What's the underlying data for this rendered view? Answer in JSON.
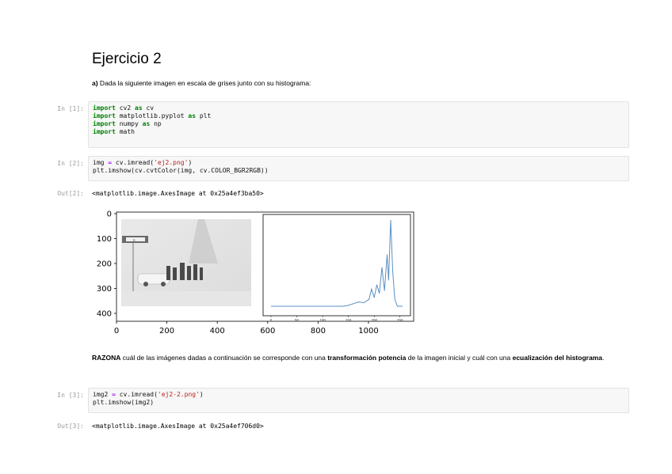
{
  "heading": "Ejercicio 2",
  "intro": {
    "bold": "a)",
    "text": " Dada la siguiente imagen en escala de grises junto con su histograma:"
  },
  "cells": [
    {
      "prompt": "In [1]:",
      "lines": [
        [
          {
            "t": "kw",
            "v": "import"
          },
          {
            "t": "",
            "v": " cv2 "
          },
          {
            "t": "kw",
            "v": "as"
          },
          {
            "t": "",
            "v": " cv"
          }
        ],
        [
          {
            "t": "kw",
            "v": "import"
          },
          {
            "t": "",
            "v": " matplotlib.pyplot "
          },
          {
            "t": "kw",
            "v": "as"
          },
          {
            "t": "",
            "v": " plt"
          }
        ],
        [
          {
            "t": "kw",
            "v": "import"
          },
          {
            "t": "",
            "v": " numpy "
          },
          {
            "t": "kw",
            "v": "as"
          },
          {
            "t": "",
            "v": " np"
          }
        ],
        [
          {
            "t": "kw",
            "v": "import"
          },
          {
            "t": "",
            "v": " math"
          }
        ]
      ]
    },
    {
      "prompt": "In [2]:",
      "lines": [
        [
          {
            "t": "",
            "v": "img "
          },
          {
            "t": "op",
            "v": "="
          },
          {
            "t": "",
            "v": " cv.imread("
          },
          {
            "t": "str",
            "v": "'ej2.png'"
          },
          {
            "t": "",
            "v": ")"
          }
        ],
        [
          {
            "t": "",
            "v": "plt.imshow(cv.cvtColor(img, cv.COLOR_BGR2RGB))"
          }
        ]
      ]
    },
    {
      "prompt": "In [3]:",
      "lines": [
        [
          {
            "t": "",
            "v": "img2 "
          },
          {
            "t": "op",
            "v": "="
          },
          {
            "t": "",
            "v": " cv.imread("
          },
          {
            "t": "str",
            "v": "'ej2-2.png'"
          },
          {
            "t": "",
            "v": ")"
          }
        ],
        [
          {
            "t": "",
            "v": "plt.imshow(img2)"
          }
        ]
      ]
    }
  ],
  "outputs": [
    {
      "prompt": "Out[2]:",
      "text": "<matplotlib.image.AxesImage at 0x25a4ef3ba50>"
    },
    {
      "prompt": "Out[3]:",
      "text": "<matplotlib.image.AxesImage at 0x25a4ef706d0>"
    }
  ],
  "plot": {
    "y_ticks": [
      "0",
      "100",
      "200",
      "300",
      "400"
    ],
    "x_ticks": [
      "0",
      "200",
      "400",
      "600",
      "800",
      "1000"
    ],
    "hist_x_ticks": [
      "0",
      "50",
      "100",
      "150",
      "200",
      "250"
    ],
    "sign_text": "K"
  },
  "razona": {
    "b1": "RAZONA",
    "t1": " cuál de las imágenes dadas a continuación se corresponde con una ",
    "b2": "transformación potencia",
    "t2": " de la imagen inicial y cuál con una ",
    "b3": "ecualización del histograma",
    "t3": "."
  },
  "chart_data": {
    "type": "line",
    "title": "",
    "xlabel": "",
    "ylabel": "",
    "x": [
      0,
      20,
      40,
      60,
      80,
      100,
      120,
      140,
      150,
      160,
      170,
      180,
      190,
      195,
      200,
      205,
      210,
      215,
      220,
      225,
      228,
      232,
      236,
      240,
      245,
      250,
      255
    ],
    "y": [
      0,
      0,
      0,
      0,
      0,
      0,
      0,
      0,
      1,
      3,
      5,
      4,
      8,
      20,
      10,
      25,
      15,
      45,
      18,
      60,
      30,
      100,
      40,
      8,
      0,
      0,
      0
    ],
    "xlim": [
      0,
      255
    ],
    "grid": false
  }
}
